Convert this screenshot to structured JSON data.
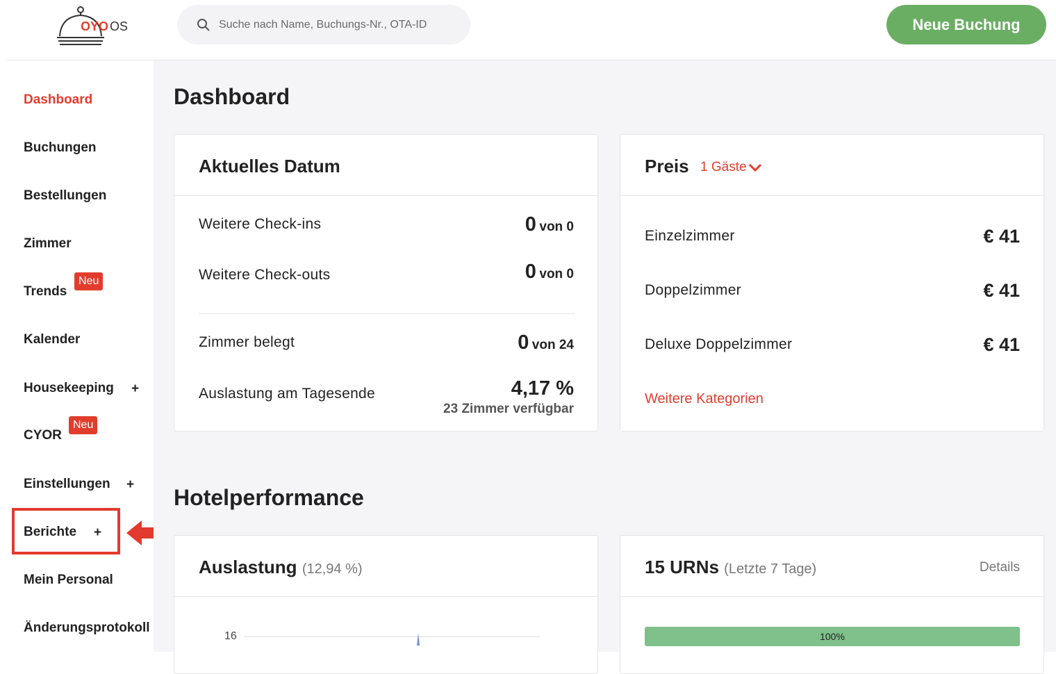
{
  "header": {
    "logo_brand": "OYO",
    "logo_suffix": "OS",
    "search_placeholder": "Suche nach Name, Buchungs-Nr., OTA-ID",
    "new_booking_label": "Neue Buchung"
  },
  "sidebar": {
    "items": [
      {
        "label": "Dashboard"
      },
      {
        "label": "Buchungen"
      },
      {
        "label": "Bestellungen"
      },
      {
        "label": "Zimmer"
      },
      {
        "label": "Trends",
        "badge": "Neu"
      },
      {
        "label": "Kalender"
      },
      {
        "label": "Housekeeping",
        "expand": "+"
      },
      {
        "label": "CYOR",
        "badge": "Neu"
      },
      {
        "label": "Einstellungen",
        "expand": "+"
      },
      {
        "label": "Berichte",
        "expand": "+"
      },
      {
        "label": "Mein Personal"
      },
      {
        "label": "Änderungsprotokoll"
      }
    ]
  },
  "main": {
    "dashboard_title": "Dashboard",
    "current_date": {
      "title": "Aktuelles Datum",
      "checkins_label": "Weitere Check-ins",
      "checkins_value": "0",
      "checkins_total": "von 0",
      "checkouts_label": "Weitere Check-outs",
      "checkouts_value": "0",
      "checkouts_total": "von 0",
      "rooms_label": "Zimmer belegt",
      "rooms_value": "0",
      "rooms_total": "von 24",
      "occupancy_label": "Auslastung am Tagesende",
      "occupancy_value": "4,17 %",
      "occupancy_sub": "23 Zimmer verfügbar"
    },
    "price": {
      "title": "Preis",
      "guests": "1 Gäste",
      "rows": [
        {
          "label": "Einzelzimmer",
          "value": "€ 41"
        },
        {
          "label": "Doppelzimmer",
          "value": "€ 41"
        },
        {
          "label": "Deluxe Doppelzimmer",
          "value": "€ 41"
        }
      ],
      "more_link": "Weitere Kategorien"
    },
    "performance_title": "Hotelperformance",
    "occupancy_card": {
      "title": "Auslastung",
      "value": "(12,94 %)",
      "y_tick": "16"
    },
    "urn_card": {
      "title": "15 URNs",
      "period": "(Letzte 7 Tage)",
      "details_link": "Details",
      "progress": 1.0,
      "progress_label": "100%"
    }
  },
  "colors": {
    "accent": "#e23d2c",
    "primary_button": "#6aae63",
    "progress_fill": "#7fc08b"
  }
}
